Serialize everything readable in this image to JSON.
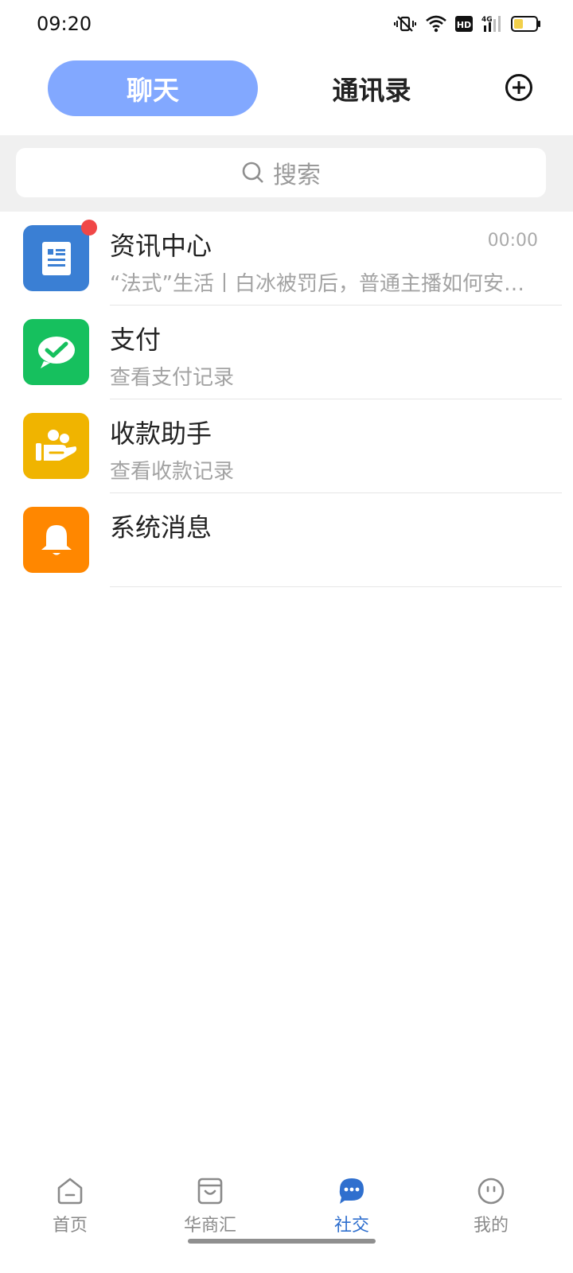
{
  "status_bar": {
    "time": "09:20",
    "network": "4G",
    "hd": "HD"
  },
  "top_tabs": {
    "chat": "聊天",
    "contacts": "通讯录"
  },
  "search": {
    "placeholder": "搜索"
  },
  "conversations": [
    {
      "title": "资讯中心",
      "subtitle": "“法式”生活丨白冰被罚后，普通主播如何安…",
      "time": "00:00",
      "icon": "news-icon",
      "color": "#3a7fd4",
      "unread": true
    },
    {
      "title": "支付",
      "subtitle": "查看支付记录",
      "time": "",
      "icon": "payment-icon",
      "color": "#16c05e",
      "unread": false
    },
    {
      "title": "收款助手",
      "subtitle": "查看收款记录",
      "time": "",
      "icon": "receipt-assistant-icon",
      "color": "#f0b400",
      "unread": false
    },
    {
      "title": "系统消息",
      "subtitle": "",
      "time": "",
      "icon": "bell-icon",
      "color": "#ff8700",
      "unread": false
    }
  ],
  "bottom_nav": [
    {
      "label": "首页",
      "icon": "home-icon",
      "active": false
    },
    {
      "label": "华商汇",
      "icon": "shop-icon",
      "active": false
    },
    {
      "label": "社交",
      "icon": "chat-bubble-icon",
      "active": true
    },
    {
      "label": "我的",
      "icon": "profile-icon",
      "active": false
    }
  ],
  "colors": {
    "accent": "#82a8ff",
    "active_nav": "#2f6fce",
    "badge": "#f04747"
  }
}
